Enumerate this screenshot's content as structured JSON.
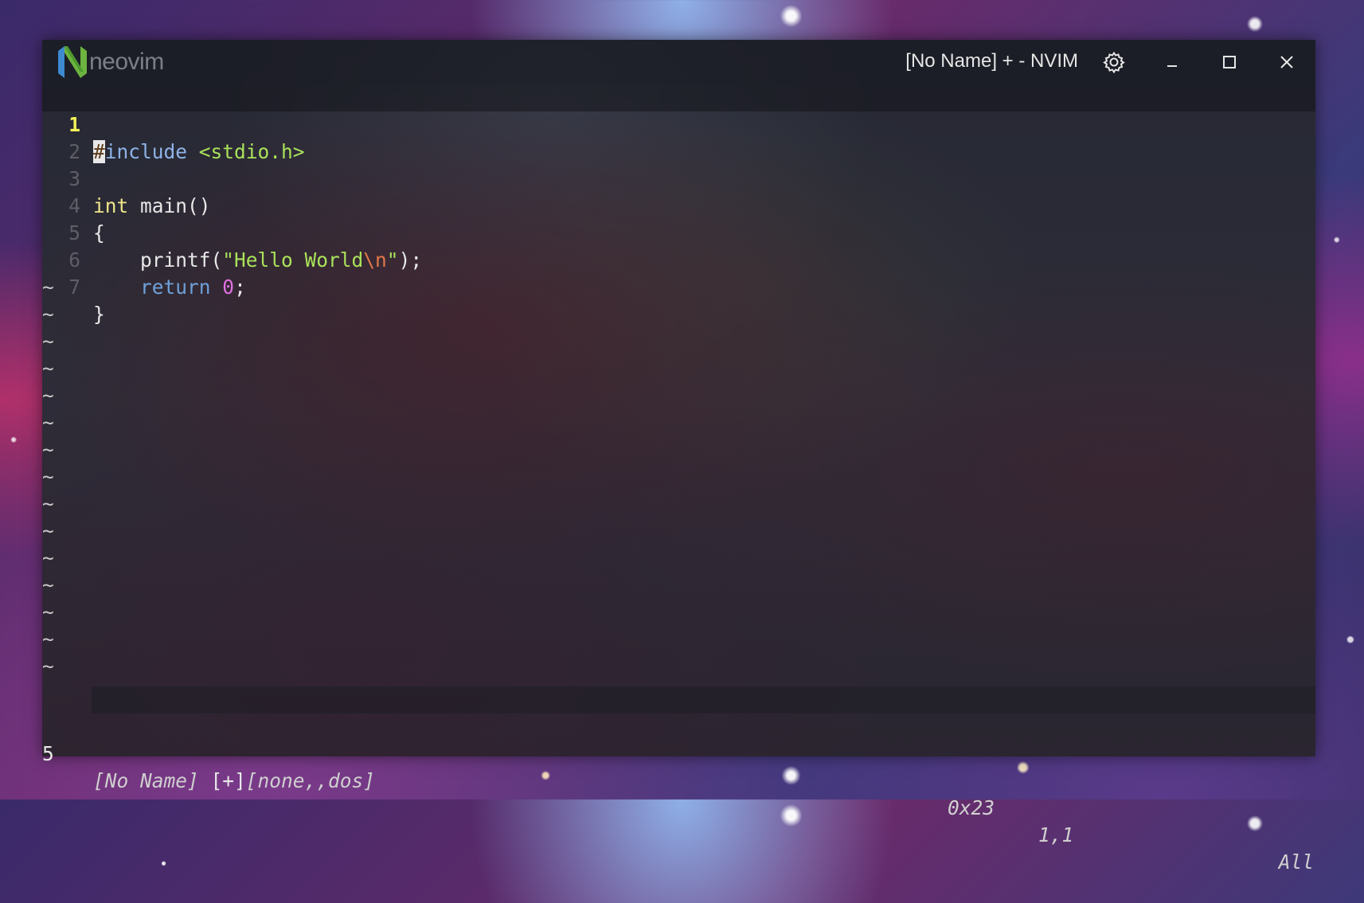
{
  "app": {
    "logo_text": "neovim",
    "window_title": "[No Name] + - NVIM",
    "icons": {
      "settings": "gear-icon",
      "minimize": "minimize-icon",
      "maximize": "maximize-icon",
      "close": "close-icon"
    }
  },
  "editor": {
    "lines": [
      {
        "num": "1",
        "current": true
      },
      {
        "num": "2"
      },
      {
        "num": "3"
      },
      {
        "num": "4"
      },
      {
        "num": "5"
      },
      {
        "num": "6"
      },
      {
        "num": "7"
      }
    ],
    "code": {
      "l1_cursor": "#",
      "l1_include": "include",
      "l1_header": " <stdio.h>",
      "l3_type": "int",
      "l3_rest": " main()",
      "l4": "{",
      "l5_indent": "    printf(",
      "l5_str": "\"Hello World",
      "l5_esc": "\\n",
      "l5_strend": "\"",
      "l5_end": ");",
      "l6_indent": "    ",
      "l6_kw": "return",
      "l6_sp": " ",
      "l6_num": "0",
      "l6_end": ";",
      "l7": "}"
    },
    "tilde": "~"
  },
  "statusline": {
    "left_num": "5",
    "file": "[No Name]",
    "modified": " [+]",
    "info": "[none,,dos]",
    "hex": "0x23",
    "position": "1,1",
    "scroll": "All"
  },
  "colors": {
    "line_number_current": "#f3f35a",
    "keyword": "#6fa0d8",
    "string": "#a9e25a",
    "type": "#f0e68c",
    "number": "#e070e0",
    "escape": "#e0784a"
  }
}
